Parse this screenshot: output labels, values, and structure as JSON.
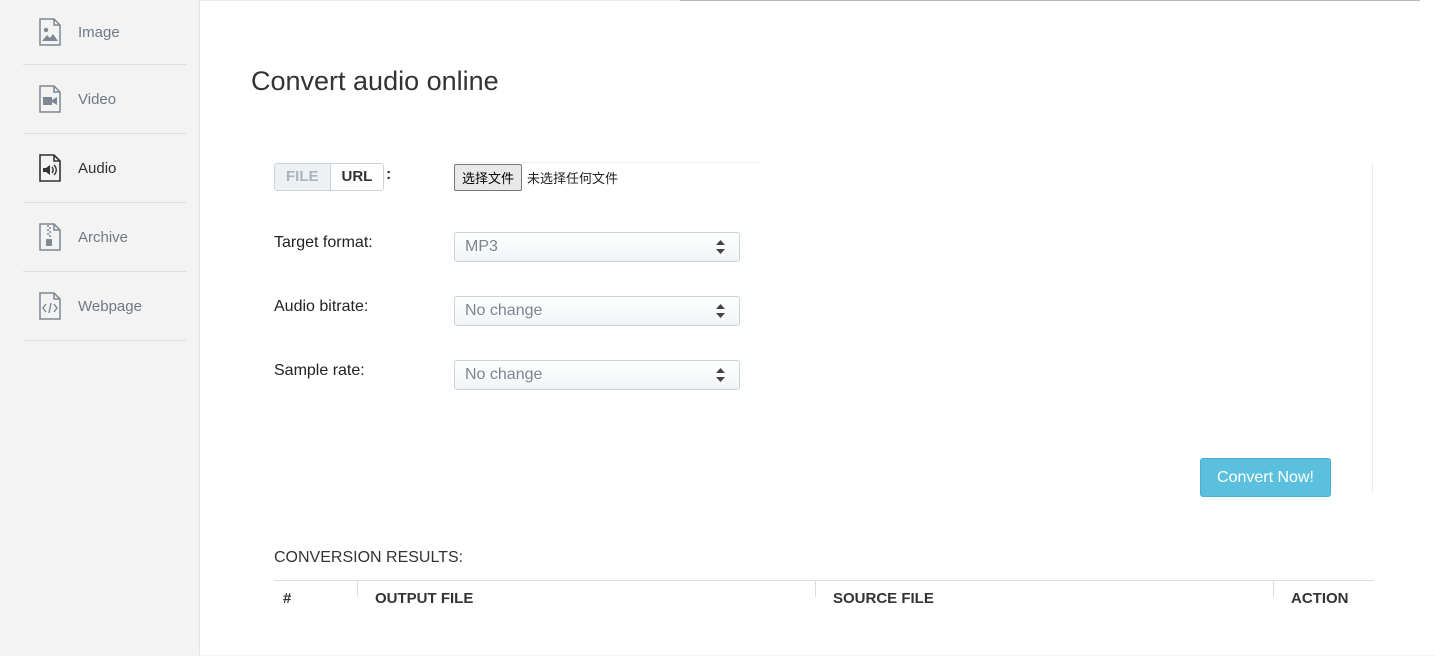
{
  "sidebar": {
    "items": [
      {
        "label": "Image",
        "icon": "image-file-icon"
      },
      {
        "label": "Video",
        "icon": "video-file-icon"
      },
      {
        "label": "Audio",
        "icon": "audio-file-icon",
        "active": true
      },
      {
        "label": "Archive",
        "icon": "archive-file-icon"
      },
      {
        "label": "Webpage",
        "icon": "code-file-icon"
      }
    ]
  },
  "main": {
    "title": "Convert audio online",
    "source_toggle": {
      "file": "FILE",
      "url": "URL",
      "colon": ":"
    },
    "file_input": {
      "button": "选择文件",
      "status": "未选择任何文件"
    },
    "form": {
      "target_format": {
        "label": "Target format:",
        "value": "MP3"
      },
      "audio_bitrate": {
        "label": "Audio bitrate:",
        "value": "No change"
      },
      "sample_rate": {
        "label": "Sample rate:",
        "value": "No change"
      }
    },
    "convert_button": "Convert Now!",
    "results": {
      "title": "CONVERSION RESULTS:",
      "columns": [
        "#",
        "OUTPUT FILE",
        "SOURCE FILE",
        "ACTION"
      ]
    }
  },
  "colors": {
    "accent": "#5bc0de",
    "sidebar_bg": "#f3f3f3",
    "muted_text": "#6f7a86"
  }
}
